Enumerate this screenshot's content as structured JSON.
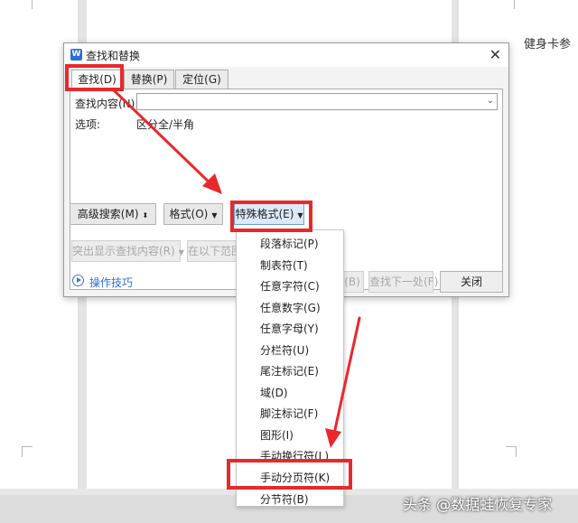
{
  "document": {
    "side_text": "健身卡参"
  },
  "dialog": {
    "title": "查找和替换",
    "tabs": [
      "查找(D)",
      "替换(P)",
      "定位(G)"
    ],
    "find_label": "查找内容(N):",
    "find_value": "",
    "options_label": "选项:",
    "options_value": "区分全/半角",
    "buttons": {
      "advanced": "高级搜索(M)",
      "format": "格式(O)",
      "special": "特殊格式(E)",
      "highlight": "突出显示查找内容(R)",
      "in_range": "在以下范围",
      "find_prev": "(B)",
      "find_next": "查找下一处(F)",
      "close": "关闭"
    },
    "tips_link": "操作技巧"
  },
  "special_menu": {
    "items": [
      "段落标记(P)",
      "制表符(T)",
      "任意字符(C)",
      "任意数字(G)",
      "任意字母(Y)",
      "分栏符(U)",
      "尾注标记(E)",
      "域(D)",
      "脚注标记(F)",
      "图形(I)",
      "手动换行符(L)",
      "手动分页符(K)",
      "分节符(B)"
    ],
    "highlighted": "手动分页符(K)"
  },
  "annotation_color": "#e8292c",
  "watermark": "头条 @数据蛙恢复专家"
}
